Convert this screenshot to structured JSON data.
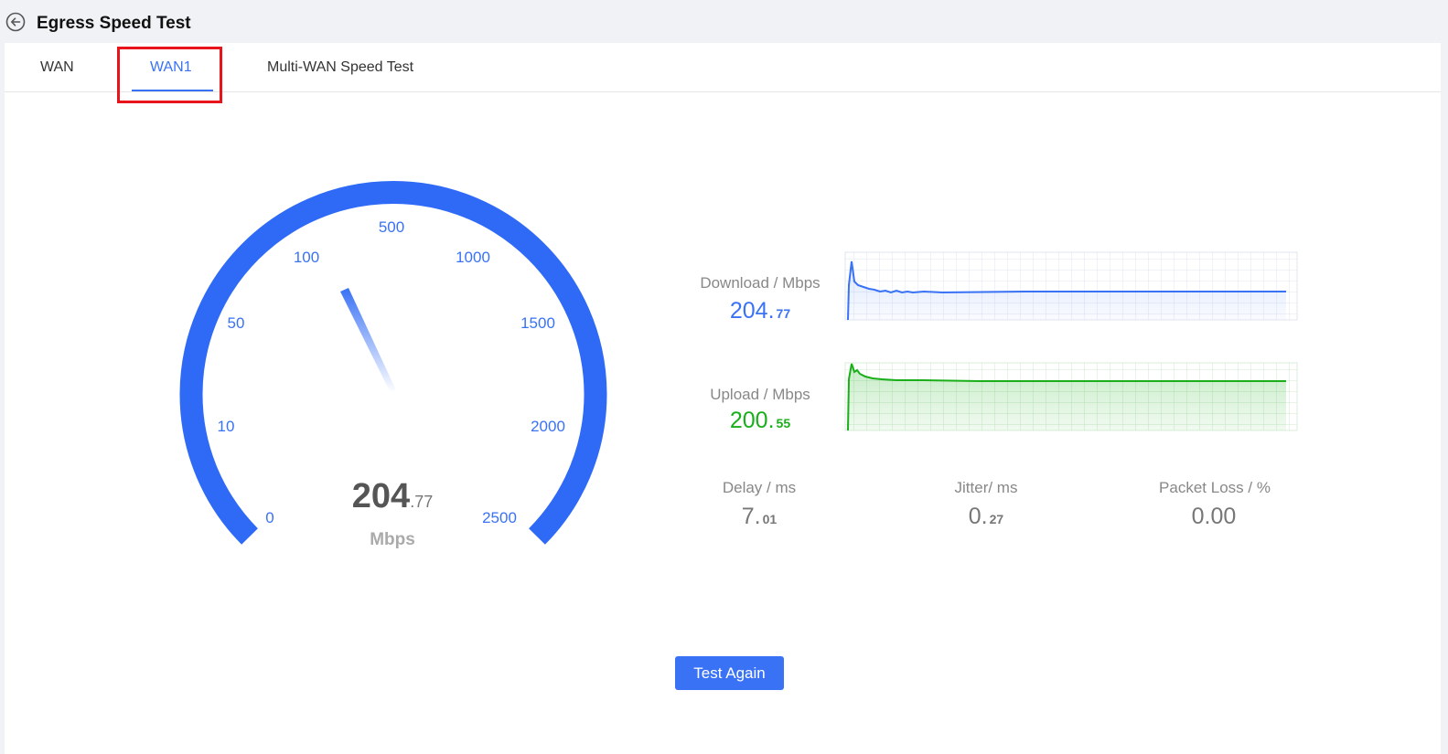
{
  "header": {
    "title": "Egress Speed Test",
    "back_icon": "arrow-left-circle-icon"
  },
  "tabs": [
    {
      "label": "WAN",
      "active": false
    },
    {
      "label": "WAN1",
      "active": true
    },
    {
      "label": "Multi-WAN Speed Test",
      "active": false
    }
  ],
  "gauge": {
    "value_int": "204",
    "value_dec": ".77",
    "unit": "Mbps",
    "ticks": [
      "0",
      "10",
      "50",
      "100",
      "500",
      "1000",
      "1500",
      "2000",
      "2500"
    ],
    "needle_level": "204.77"
  },
  "download": {
    "label": "Download / Mbps",
    "value_int": "204.",
    "value_dec": "77"
  },
  "upload": {
    "label": "Upload / Mbps",
    "value_int": "200.",
    "value_dec": "55"
  },
  "stats": [
    {
      "label": "Delay / ms",
      "value_int": "7.",
      "value_dec": "01"
    },
    {
      "label": "Jitter/ ms",
      "value_int": "0.",
      "value_dec": "27"
    },
    {
      "label": "Packet Loss / %",
      "value_int": "0.00",
      "value_dec": ""
    }
  ],
  "actions": {
    "test_again": "Test Again"
  },
  "colors": {
    "accent": "#3a72f5",
    "upload": "#1aaf1a",
    "highlight": "#e8141a"
  }
}
